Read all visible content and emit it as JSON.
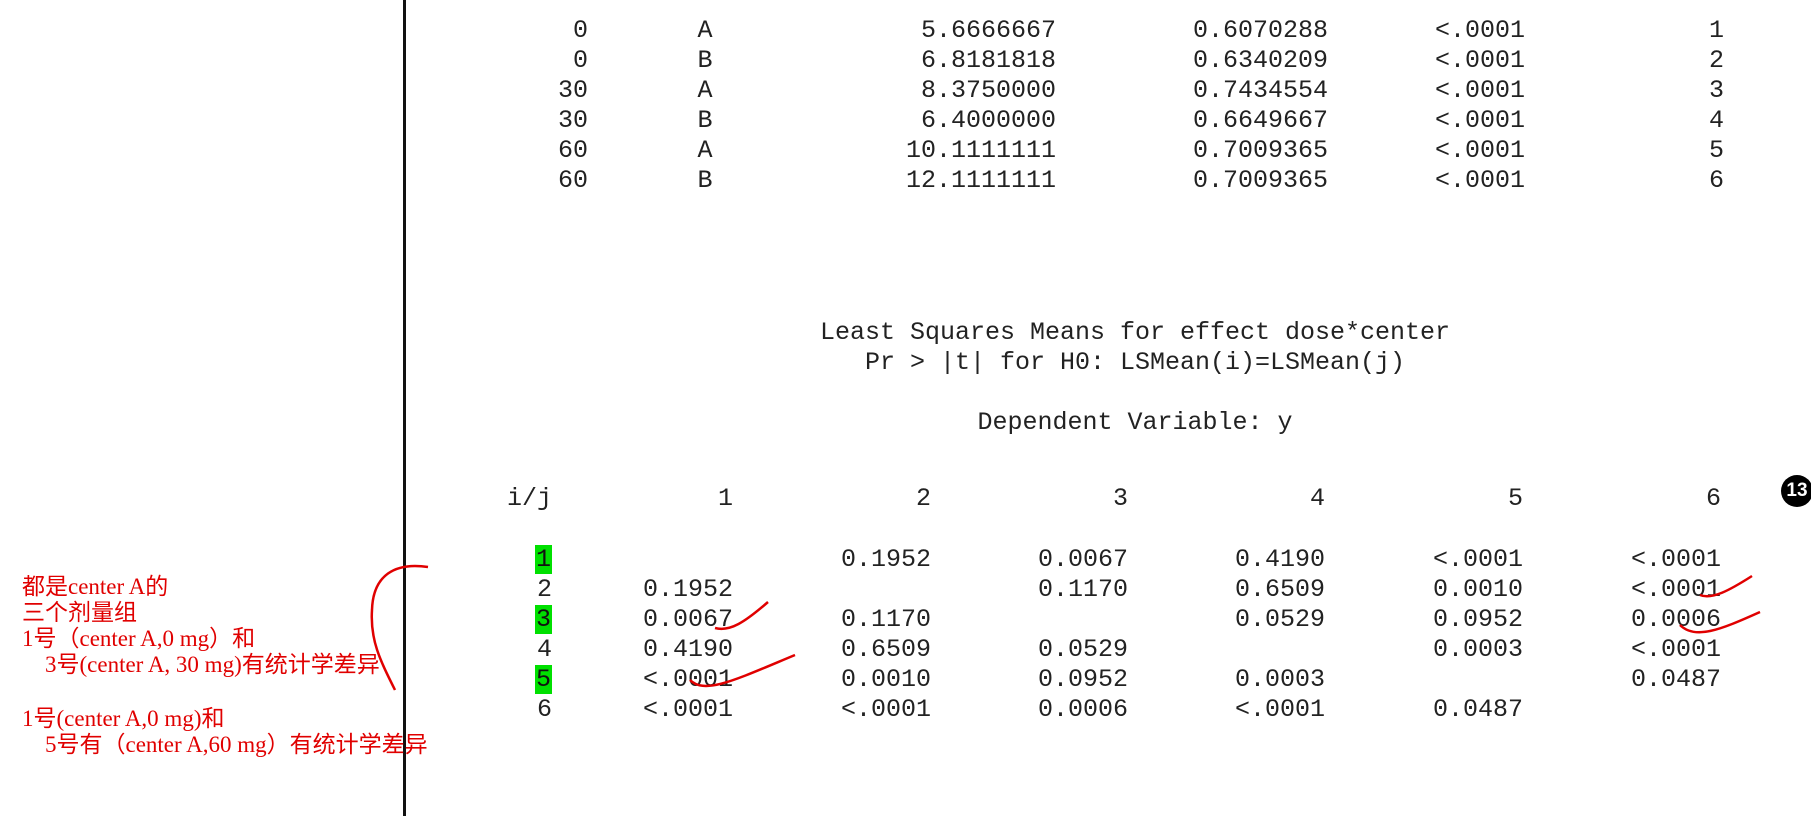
{
  "top_table": {
    "rows": [
      {
        "dose": "0",
        "center": "A",
        "lsmean": "5.6666667",
        "stderr": "0.6070288",
        "p": "<.0001",
        "num": "1"
      },
      {
        "dose": "0",
        "center": "B",
        "lsmean": "6.8181818",
        "stderr": "0.6340209",
        "p": "<.0001",
        "num": "2"
      },
      {
        "dose": "30",
        "center": "A",
        "lsmean": "8.3750000",
        "stderr": "0.7434554",
        "p": "<.0001",
        "num": "3"
      },
      {
        "dose": "30",
        "center": "B",
        "lsmean": "6.4000000",
        "stderr": "0.6649667",
        "p": "<.0001",
        "num": "4"
      },
      {
        "dose": "60",
        "center": "A",
        "lsmean": "10.1111111",
        "stderr": "0.7009365",
        "p": "<.0001",
        "num": "5"
      },
      {
        "dose": "60",
        "center": "B",
        "lsmean": "12.1111111",
        "stderr": "0.7009365",
        "p": "<.0001",
        "num": "6"
      }
    ]
  },
  "matrix": {
    "title_line1": "Least Squares Means for effect dose*center",
    "title_line2": "Pr > |t| for H0: LSMean(i)=LSMean(j)",
    "dependent": "Dependent Variable: y",
    "corner_label": "i/j",
    "col_headers": [
      "1",
      "2",
      "3",
      "4",
      "5",
      "6"
    ],
    "rows": [
      {
        "label": "1",
        "highlight": true,
        "cells": [
          "",
          "0.1952",
          "0.0067",
          "0.4190",
          "<.0001",
          "<.0001"
        ]
      },
      {
        "label": "2",
        "highlight": false,
        "cells": [
          "0.1952",
          "",
          "0.1170",
          "0.6509",
          "0.0010",
          "<.0001"
        ]
      },
      {
        "label": "3",
        "highlight": true,
        "cells": [
          "0.0067",
          "0.1170",
          "",
          "0.0529",
          "0.0952",
          "0.0006"
        ]
      },
      {
        "label": "4",
        "highlight": false,
        "cells": [
          "0.4190",
          "0.6509",
          "0.0529",
          "",
          "0.0003",
          "<.0001"
        ]
      },
      {
        "label": "5",
        "highlight": true,
        "cells": [
          "<.0001",
          "0.0010",
          "0.0952",
          "0.0003",
          "",
          "0.0487"
        ]
      },
      {
        "label": "6",
        "highlight": false,
        "cells": [
          "<.0001",
          "<.0001",
          "0.0006",
          "<.0001",
          "0.0487",
          ""
        ]
      }
    ]
  },
  "notes": {
    "line1": "都是center A的",
    "line2": "三个剂量组",
    "line3": "1号（center A,0 mg）和",
    "line4": "    3号(center A, 30 mg)有统计学差异",
    "line5": "1号(center A,0 mg)和",
    "line6": "    5号有（center A,60 mg）有统计学差异"
  },
  "page_badge": "13",
  "colors": {
    "annotation": "#e00000",
    "highlight": "#00e000",
    "text": "#222222"
  }
}
